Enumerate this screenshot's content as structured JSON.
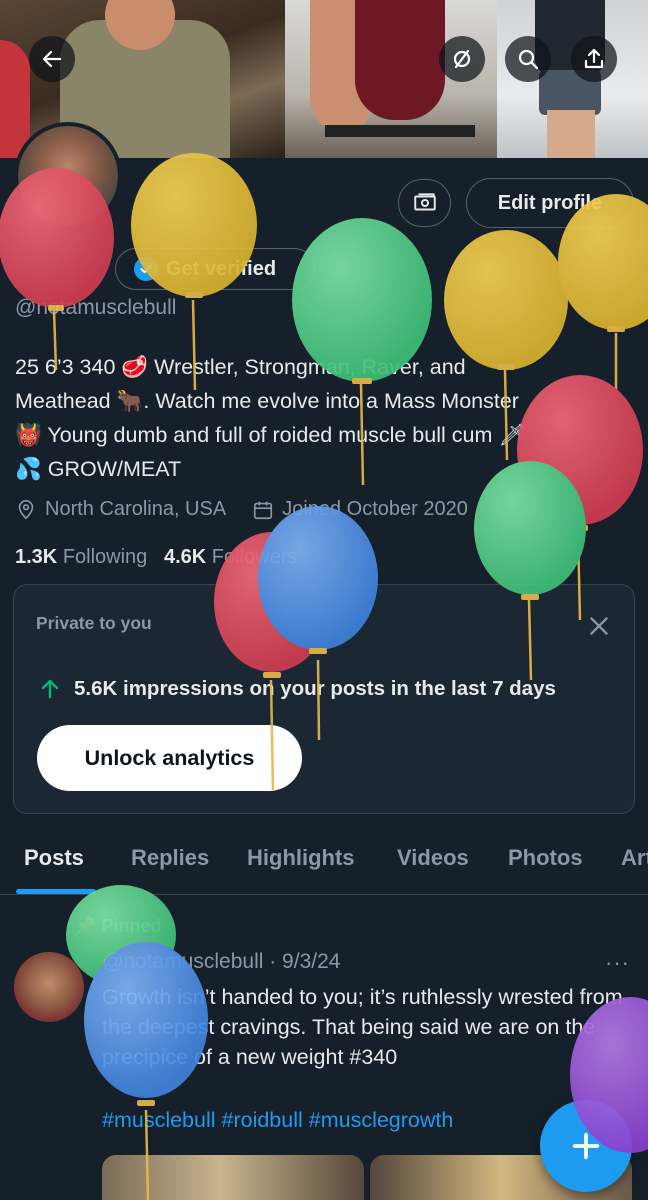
{
  "header": {
    "back_icon": "arrow-left-icon",
    "hide_icon": "eye-off-icon",
    "search_icon": "search-icon",
    "share_icon": "share-upload-icon"
  },
  "profile": {
    "money_icon": "money-icon",
    "edit_label": "Edit profile",
    "verified_label": "Get verified",
    "handle": "@notamusclebull",
    "bio": [
      "25 6’3 340 🥩 Wrestler, Strongman, Raver, and",
      "Meathead 🐂. Watch me evolve into a Mass Monster",
      "👹 Young dumb and full of roided muscle bull cum 🗡",
      "💦 GROW/MEAT"
    ],
    "location": "North Carolina, USA",
    "joined": "Joined October 2020",
    "following_count": "1.3K",
    "following_label": "Following",
    "followers_count": "4.6K",
    "followers_label": "Followers"
  },
  "analytics_card": {
    "title": "Private to you",
    "impressions": "5.6K impressions on your posts in the last 7 days",
    "button": "Unlock analytics"
  },
  "tabs": [
    "Posts",
    "Replies",
    "Highlights",
    "Videos",
    "Photos",
    "Articles"
  ],
  "post": {
    "pinned_label": "Pinned",
    "author": "@notamusclebull · 9/3/24",
    "more": "···",
    "text": "Growth isn’t handed to you; it’s ruthlessly wrested from the deepest cravings. That being said we are on the precipice of a new weight #340",
    "hashtags": "#musclebull #roidbull #musclegrowth"
  },
  "colors": {
    "background": "#15202b",
    "accent": "#1d9bf0",
    "secondary_text": "#8b98a5",
    "impression_arrow": "#00ba7c"
  }
}
